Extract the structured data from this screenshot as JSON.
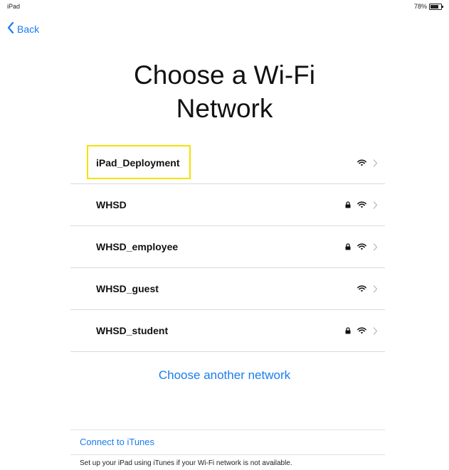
{
  "status_bar": {
    "device": "iPad",
    "battery_percent": "78%",
    "battery_level": 0.78
  },
  "nav": {
    "back_label": "Back"
  },
  "title": {
    "line1": "Choose a Wi-Fi",
    "line2": "Network"
  },
  "networks": [
    {
      "name": "iPad_Deployment",
      "locked": false,
      "highlighted": true
    },
    {
      "name": "WHSD",
      "locked": true,
      "highlighted": false
    },
    {
      "name": "WHSD_employee",
      "locked": true,
      "highlighted": false
    },
    {
      "name": "WHSD_guest",
      "locked": false,
      "highlighted": false
    },
    {
      "name": "WHSD_student",
      "locked": true,
      "highlighted": false
    }
  ],
  "other_network_label": "Choose another network",
  "itunes": {
    "link_label": "Connect to iTunes",
    "note": "Set up your iPad using iTunes if your Wi-Fi network is not available."
  },
  "colors": {
    "accent": "#1a7cf0",
    "highlight": "#f2e200"
  }
}
